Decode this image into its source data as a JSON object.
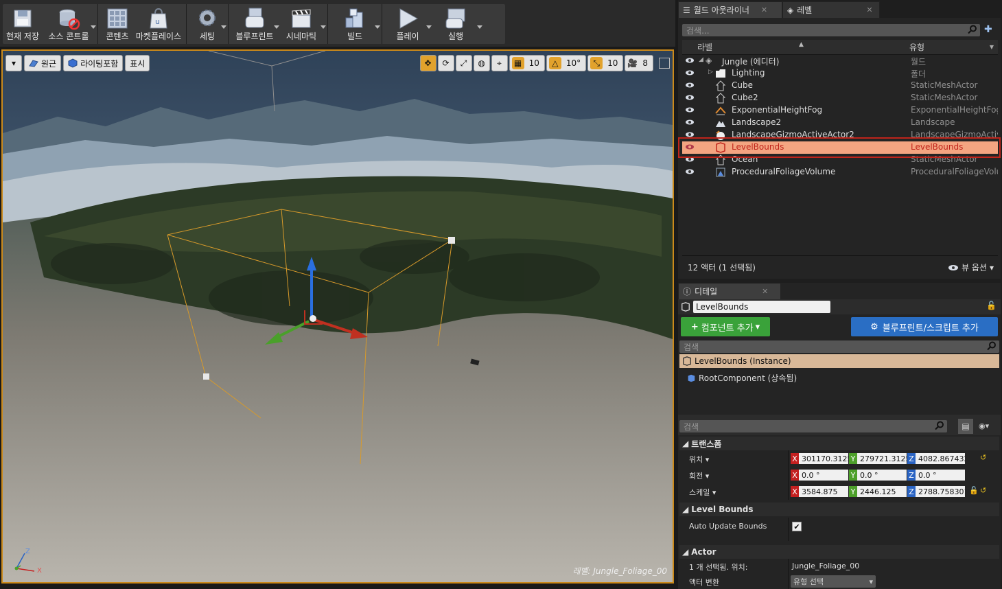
{
  "toolbar": {
    "buttons": [
      {
        "label": "현재 저장"
      },
      {
        "label": "소스 콘트롤"
      },
      {
        "label": "콘텐츠"
      },
      {
        "label": "마켓플레이스"
      },
      {
        "label": "세팅"
      },
      {
        "label": "블루프린트"
      },
      {
        "label": "시네마틱"
      },
      {
        "label": "빌드"
      },
      {
        "label": "플레이"
      },
      {
        "label": "실행"
      }
    ]
  },
  "viewport": {
    "left_tools": {
      "perspective": "원근",
      "lighting": "라이팅포함",
      "show": "표시"
    },
    "right_tools": {
      "grid_snap": "10",
      "rotation_snap": "10°",
      "scale_snap": "10",
      "camera_speed": "8"
    },
    "level_label": "레벨:  Jungle_Foliage_00",
    "axis": {
      "z": "Z",
      "x": "X"
    }
  },
  "outliner": {
    "tab_label": "월드 아웃라이너",
    "tab_levels": "레벨",
    "search_placeholder": "검색...",
    "col_label": "라벨",
    "col_type": "유형",
    "rows": [
      {
        "name": "Jungle (에디터)",
        "type": "월드"
      },
      {
        "name": "Lighting",
        "type": "폴더"
      },
      {
        "name": "Cube",
        "type": "StaticMeshActor"
      },
      {
        "name": "Cube2",
        "type": "StaticMeshActor"
      },
      {
        "name": "ExponentialHeightFog",
        "type": "ExponentialHeightFog"
      },
      {
        "name": "Landscape2",
        "type": "Landscape"
      },
      {
        "name": "LandscapeGizmoActiveActor2",
        "type": "LandscapeGizmoActive"
      },
      {
        "name": "LevelBounds",
        "type": "LevelBounds"
      },
      {
        "name": "Ocean",
        "type": "StaticMeshActor"
      },
      {
        "name": "ProceduralFoliageVolume",
        "type": "ProceduralFoliageVolu"
      }
    ],
    "actor_count": "12 액터 (1 선택됨)",
    "view_options": "뷰 옵션"
  },
  "details": {
    "tab_label": "디테일",
    "name_value": "LevelBounds",
    "add_component": "컴포넌트 추가",
    "add_blueprint": "블루프린트/스크립트 추가",
    "search_placeholder": "검색",
    "instance_label": "LevelBounds (Instance)",
    "root_component": "RootComponent (상속됨)",
    "search2_placeholder": "검색",
    "transform": {
      "title": "트랜스폼",
      "location_label": "위치",
      "rotation_label": "회전",
      "scale_label": "스케일",
      "location": {
        "x": "301170.3125",
        "y": "279721.3125",
        "z": "4082.867432"
      },
      "rotation": {
        "x": "0.0 °",
        "y": "0.0 °",
        "z": "0.0 °"
      },
      "scale": {
        "x": "3584.875",
        "y": "2446.125",
        "z": "2788.758301"
      },
      "axis": {
        "x": "X",
        "y": "Y",
        "z": "Z"
      }
    },
    "level_bounds": {
      "title": "Level Bounds",
      "auto_update_label": "Auto Update Bounds",
      "auto_update_checked": "✔"
    },
    "actor": {
      "title": "Actor",
      "selected_label": "1 개 선택됨. 위치:",
      "selected_value": "Jungle_Foliage_00",
      "convert_label": "액터 변환",
      "convert_value": "유형 선택"
    }
  }
}
